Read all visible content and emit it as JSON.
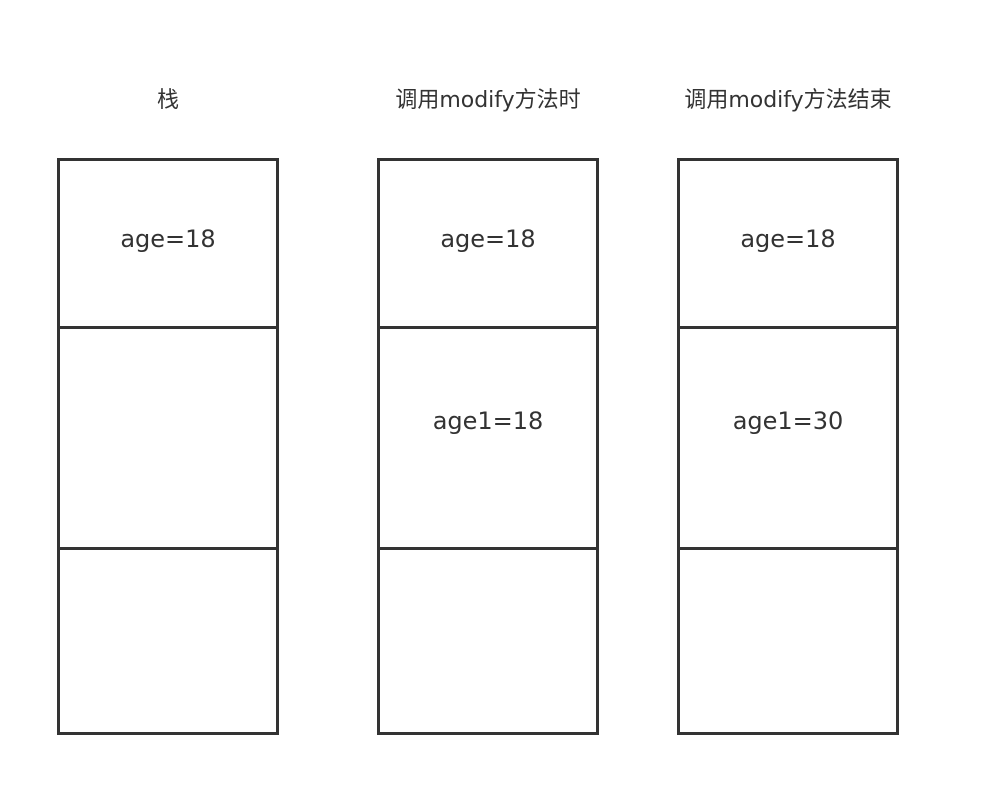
{
  "columns": [
    {
      "title": "栈",
      "cells": [
        "age=18",
        "",
        ""
      ]
    },
    {
      "title": "调用modify方法时",
      "cells": [
        "age=18",
        "age1=18",
        ""
      ]
    },
    {
      "title": "调用modify方法结束",
      "cells": [
        "age=18",
        "age1=30",
        ""
      ]
    }
  ]
}
